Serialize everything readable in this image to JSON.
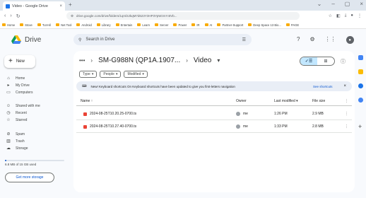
{
  "browser": {
    "tab_title": "Video - Google Drive",
    "url": "drive.google.com/drive/folders/1qml3JkqM7d623Y3HP3YpWzmY4tVb...",
    "bookmarks": [
      "Home",
      "Stove",
      "Tut-Hil",
      "Net Tool",
      "Android",
      "Library",
      "Entertain",
      "Learn",
      "Server",
      "Power",
      "IR",
      "AI",
      "Partner-Support",
      "Deep Space 13 Bio...",
      "PAGE"
    ],
    "colors": {
      "chrome_bg": "#dfe6ee",
      "bookmark_folder": "#f9ab00"
    }
  },
  "drive": {
    "app_name": "Drive",
    "search_placeholder": "Search in Drive",
    "new_button": "New",
    "nav": [
      {
        "label": "Home",
        "icon": "home-icon"
      },
      {
        "label": "My Drive",
        "icon": "my-drive-icon"
      },
      {
        "label": "Computers",
        "icon": "computers-icon"
      },
      {
        "label": "Shared with me",
        "icon": "shared-icon"
      },
      {
        "label": "Recent",
        "icon": "recent-icon"
      },
      {
        "label": "Starred",
        "icon": "star-icon"
      },
      {
        "label": "Spam",
        "icon": "spam-icon"
      },
      {
        "label": "Trash",
        "icon": "trash-icon"
      },
      {
        "label": "Storage",
        "icon": "cloud-icon"
      }
    ],
    "storage_text": "6.8 MB of 15 GB used",
    "storage_fraction": 0.02,
    "get_more_storage": "Get more storage",
    "breadcrumb": {
      "dots": "•••",
      "device": "SM-G988N (QP1A.1907...",
      "folder": "Video"
    },
    "filters": [
      "Type",
      "People",
      "Modified"
    ],
    "banner": {
      "text": "New! Keyboard shortcuts On Keyboard shortcuts have been updated to give you first-letters navigation",
      "link": "See shortcuts"
    },
    "table": {
      "headers": {
        "name": "Name",
        "owner": "Owner",
        "last_modified": "Last modified",
        "file_size": "File size"
      },
      "rows": [
        {
          "name": "2024-08-25T10.20.25-0700.ts",
          "owner": "me",
          "modified": "1:26 PM",
          "size": "2.9 MB"
        },
        {
          "name": "2024-08-25T10.27.40-0700.ts",
          "owner": "me",
          "modified": "1:33 PM",
          "size": "2.8 MB"
        }
      ]
    },
    "colors": {
      "accent": "#0b57d0",
      "selected": "#c2e7ff",
      "file_icon": "#ea4335"
    }
  }
}
